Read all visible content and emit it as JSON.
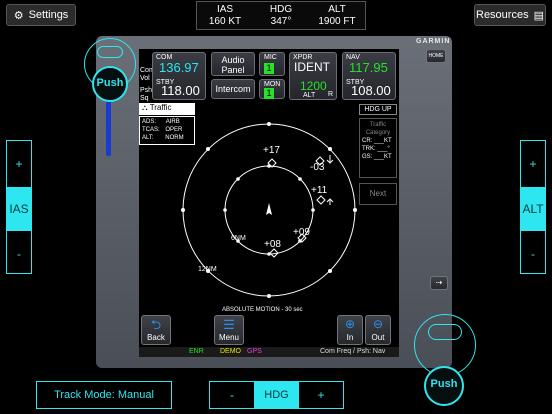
{
  "top_bar": {
    "settings_label": "Settings",
    "resources_label": "Resources",
    "readouts": [
      {
        "label": "IAS",
        "value": "160 KT"
      },
      {
        "label": "HDG",
        "value": "347°"
      },
      {
        "label": "ALT",
        "value": "1900 FT"
      }
    ]
  },
  "left_panel": {
    "plus": "+",
    "label": "IAS",
    "minus": "-"
  },
  "right_panel": {
    "plus": "+",
    "label": "ALT",
    "minus": "-"
  },
  "brand": "GARMIN",
  "home_label": "HOME",
  "knob_push": "Push",
  "left_side_labels": {
    "com_vol": "Com Vol",
    "psh_sq": "Psh Sq"
  },
  "com": {
    "label": "COM",
    "active": "136.97",
    "stby_label": "STBY",
    "standby": "118.00"
  },
  "audio_panel": "Audio Panel",
  "intercom": "Intercom",
  "mic": {
    "label": "MIC",
    "value": "1"
  },
  "mon": {
    "label": "MON",
    "value": "1"
  },
  "xpdr": {
    "label": "XPDR",
    "mode": "IDENT",
    "code": "1200",
    "sub": "ALT",
    "sub2": "R"
  },
  "nav": {
    "label": "NAV",
    "active": "117.95",
    "stby_label": "STBY",
    "standby": "108.00"
  },
  "traffic": {
    "title": "Traffic",
    "ads_label": "ADS:",
    "ads_value": "AIRB",
    "tcas_label": "TCAS:",
    "tcas_value": "OPER",
    "alt_label": "ALT:",
    "alt_value": "NORM",
    "hdg_up": "HDG UP",
    "category_label": "Traffic Category",
    "cr_label": "CR:",
    "cr_unit": "KT",
    "trk_label": "TRK:",
    "trk_unit": "°",
    "gs_label": "GS:",
    "gs_unit": "KT",
    "next_label": "Next",
    "ring_inner": "6NM",
    "ring_outer": "12NM",
    "targets": [
      "+17",
      "-03",
      "+11",
      "+09",
      "+08"
    ],
    "motion_label": "ABSOLUTE MOTION - 30 sec"
  },
  "bottom_buttons": {
    "back": "Back",
    "menu": "Menu",
    "in": "In",
    "out": "Out"
  },
  "status_bar": {
    "enr": "ENR",
    "demo": "DEMO",
    "gps": "GPS",
    "right": "Com Freq / Psh: Nav"
  },
  "bottom_bar": {
    "track_mode": "Track Mode: Manual",
    "hdg_minus": "-",
    "hdg_label": "HDG",
    "hdg_plus": "+"
  },
  "colors": {
    "accent": "#2ee6f0",
    "green": "#28e028",
    "magenta": "#e040e0",
    "yellow": "#e8e800"
  }
}
